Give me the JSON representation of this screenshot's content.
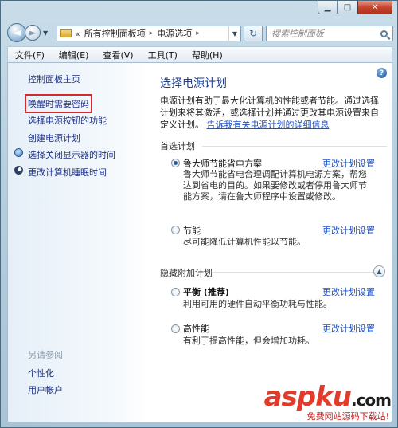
{
  "window": {
    "caption": {
      "minimize": "▁",
      "maximize": "□",
      "close": "✕"
    }
  },
  "nav": {
    "back_icon": "back-arrow-icon",
    "forward_icon": "forward-arrow-icon"
  },
  "address": {
    "chevron": "«",
    "crumbs": [
      "所有控制面板项",
      "电源选项"
    ],
    "sep": "▸"
  },
  "search": {
    "placeholder": "搜索控制面板"
  },
  "menu": [
    "文件(F)",
    "编辑(E)",
    "查看(V)",
    "工具(T)",
    "帮助(H)"
  ],
  "sidebar": {
    "home": "控制面板主页",
    "links": [
      "唤醒时需要密码",
      "选择电源按钮的功能",
      "创建电源计划",
      "选择关闭显示器的时间",
      "更改计算机睡眠时间"
    ],
    "see_also": "另请参阅",
    "see_also_links": [
      "个性化",
      "用户帐户"
    ]
  },
  "main": {
    "title": "选择电源计划",
    "desc_1": "电源计划有助于最大化计算机的性能或者节能。通过选择计划来将其激活，或选择计划并通过更改其电源设置来自定义计划。",
    "desc_link": "告诉我有关电源计划的详细信息",
    "preferred": "首选计划",
    "hidden": "隐藏附加计划",
    "change_label": "更改计划设置",
    "plans": [
      {
        "name": "鲁大师节能省电方案",
        "selected": true,
        "desc": "鲁大师节能省电合理调配计算机电源方案，帮您达到省电的目的。如果要修改或者停用鲁大师节能方案，请在鲁大师程序中设置或修改。"
      },
      {
        "name": "节能",
        "selected": false,
        "desc": "尽可能降低计算机性能以节能。"
      },
      {
        "name": "平衡 (推荐)",
        "selected": false,
        "desc": "利用可用的硬件自动平衡功耗与性能。"
      },
      {
        "name": "高性能",
        "selected": false,
        "desc": "有利于提高性能，但会增加功耗。"
      }
    ]
  },
  "watermark": {
    "brand": "aspku",
    "tld": ".com",
    "tagline": "免费网站源码下载站!"
  },
  "colors": {
    "link": "#1e50c7",
    "title": "#1e3e8c",
    "highlight_box": "#d42a2a"
  }
}
